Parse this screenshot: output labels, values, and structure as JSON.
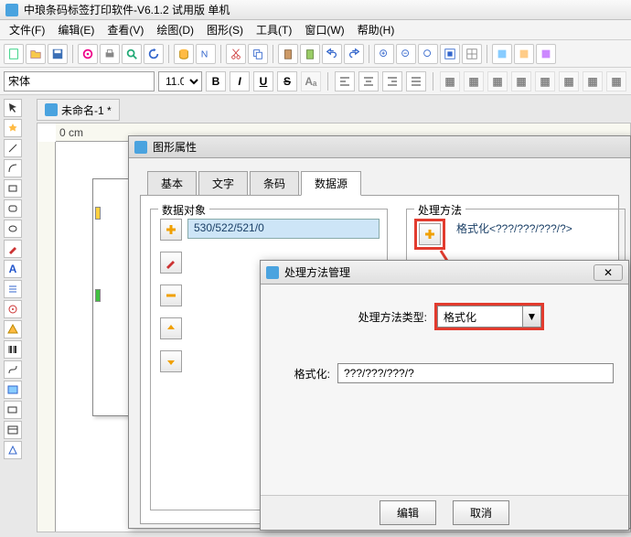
{
  "app": {
    "title": "中琅条码标签打印软件-V6.1.2 试用版 单机"
  },
  "menu": {
    "file": "文件(F)",
    "edit": "编辑(E)",
    "view": "查看(V)",
    "draw": "绘图(D)",
    "shape": "图形(S)",
    "tool": "工具(T)",
    "window": "窗口(W)",
    "help": "帮助(H)"
  },
  "font": {
    "name": "宋体",
    "size": "11.0"
  },
  "doc": {
    "tab": "未命名-1 *",
    "ruler_unit": "0 cm"
  },
  "dlg1": {
    "title": "图形属性",
    "tabs": {
      "basic": "基本",
      "text": "文字",
      "barcode": "条码",
      "datasrc": "数据源"
    },
    "group_left": "数据对象",
    "group_right": "处理方法",
    "item_left": "530/522/521/0",
    "item_right": "格式化<???/???/???/?>"
  },
  "dlg2": {
    "title": "处理方法管理",
    "type_label": "处理方法类型:",
    "type_value": "格式化",
    "fmt_label": "格式化:",
    "fmt_value": "???/???/???/?",
    "btn_edit": "编辑",
    "btn_cancel": "取消",
    "close": "✕"
  }
}
